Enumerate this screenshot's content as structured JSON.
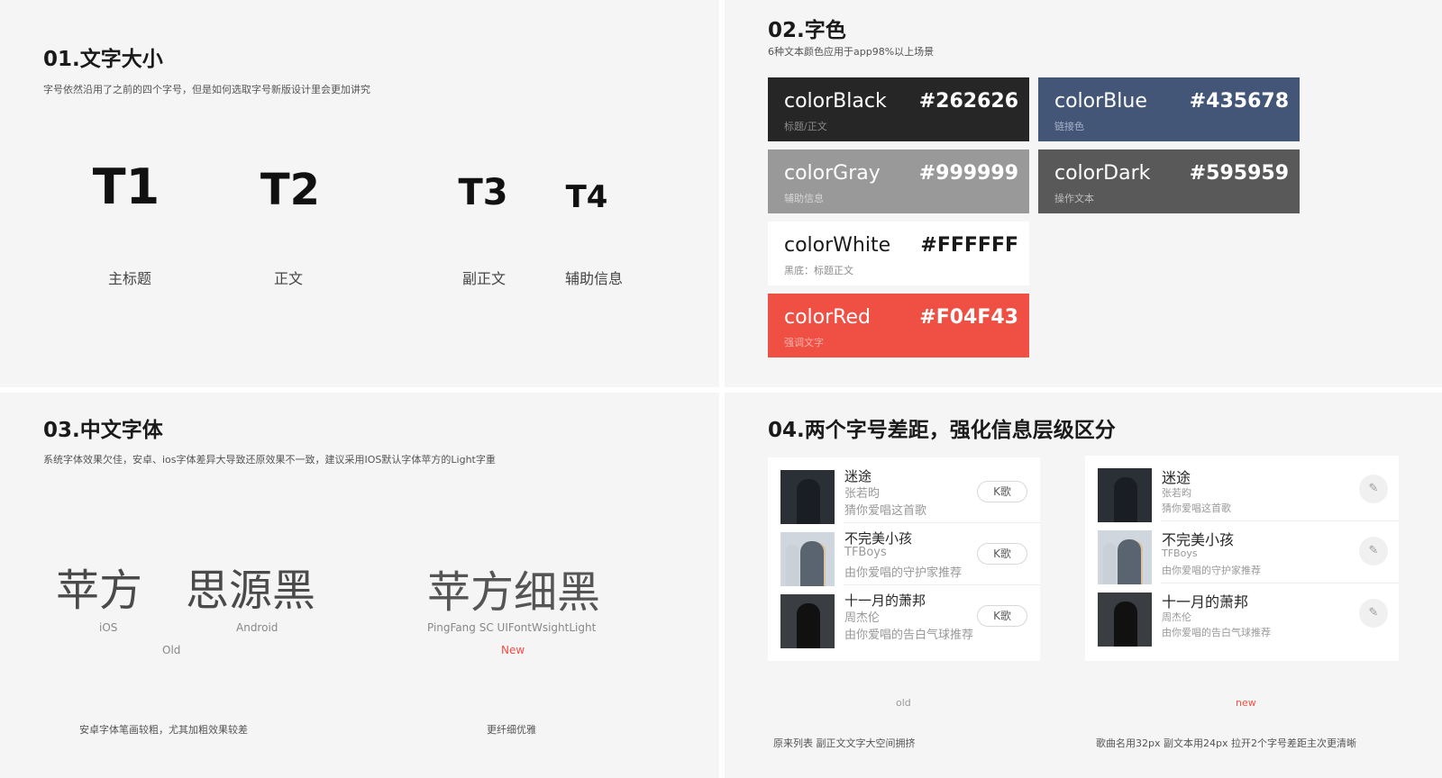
{
  "sec1": {
    "title": "01.文字大小",
    "subtitle": "字号依然沿用了之前的四个字号，但是如何选取字号新版设计里会更加讲究",
    "sizes": [
      {
        "code": "T1",
        "label": "主标题"
      },
      {
        "code": "T2",
        "label": "正文"
      },
      {
        "code": "T3",
        "label": "副正文"
      },
      {
        "code": "T4",
        "label": "辅助信息"
      }
    ]
  },
  "sec2": {
    "title": "02.字色",
    "subtitle": "6种文本颜色应用于app98%以上场景",
    "colors": [
      {
        "name": "colorBlack",
        "hex": "#262626",
        "desc": "标题/正文",
        "bg": "#262626",
        "fg": "#ffffff",
        "sub": "#8c8c8c"
      },
      {
        "name": "colorBlue",
        "hex": "#435678",
        "desc": "链接色",
        "bg": "#435678",
        "fg": "#ffffff",
        "sub": "#a7b3c8"
      },
      {
        "name": "colorGray",
        "hex": "#999999",
        "desc": "辅助信息",
        "bg": "#999999",
        "fg": "#ffffff",
        "sub": "#d6d6d6"
      },
      {
        "name": "colorDark",
        "hex": "#595959",
        "desc": "操作文本",
        "bg": "#595959",
        "fg": "#ffffff",
        "sub": "#bdbdbd"
      },
      {
        "name": "colorWhite",
        "hex": "#FFFFFF",
        "desc": "黑底：标题正文",
        "bg": "#FFFFFF",
        "fg": "#1a1a1a",
        "sub": "#8c8c8c"
      },
      {
        "name": "colorRed",
        "hex": "#F04F43",
        "desc": "强调文字",
        "bg": "#F04F43",
        "fg": "#ffffff",
        "sub": "#f8b1ab"
      }
    ]
  },
  "sec3": {
    "title": "03.中文字体",
    "subtitle": "系统字体效果欠佳，安卓、ios字体差异大导致还原效果不一致，建议采用IOS默认字体苹方的Light字重",
    "fonts": [
      {
        "sample": "苹方",
        "label": "iOS"
      },
      {
        "sample": "思源黑",
        "label": "Android"
      },
      {
        "sample": "苹方细黑",
        "label": "PingFang SC  UIFontWsightLight"
      }
    ],
    "old_label": "Old",
    "new_label": "New",
    "old_note": "安卓字体笔画较粗，尤其加粗效果较差",
    "new_note": "更纤细优雅",
    "accent": "#F04F43"
  },
  "sec4": {
    "title": "04.两个字号差距，强化信息层级区分",
    "songs": [
      {
        "title": "迷途",
        "artist": "张若昀",
        "reason": "猜你爱唱这首歌"
      },
      {
        "title": "不完美小孩",
        "artist": "TFBoys",
        "reason": "由你爱唱的守护家推荐"
      },
      {
        "title": "十一月的萧邦",
        "artist": "周杰伦",
        "reason": "由你爱唱的告白气球推荐"
      }
    ],
    "k_button": "K歌",
    "mic_icon": "microphone-icon",
    "old_label": "old",
    "new_label": "new",
    "old_caption": "原来列表 副正文文字大空间拥挤",
    "new_caption": "歌曲名用32px 副文本用24px 拉开2个字号差距主次更清晰"
  }
}
